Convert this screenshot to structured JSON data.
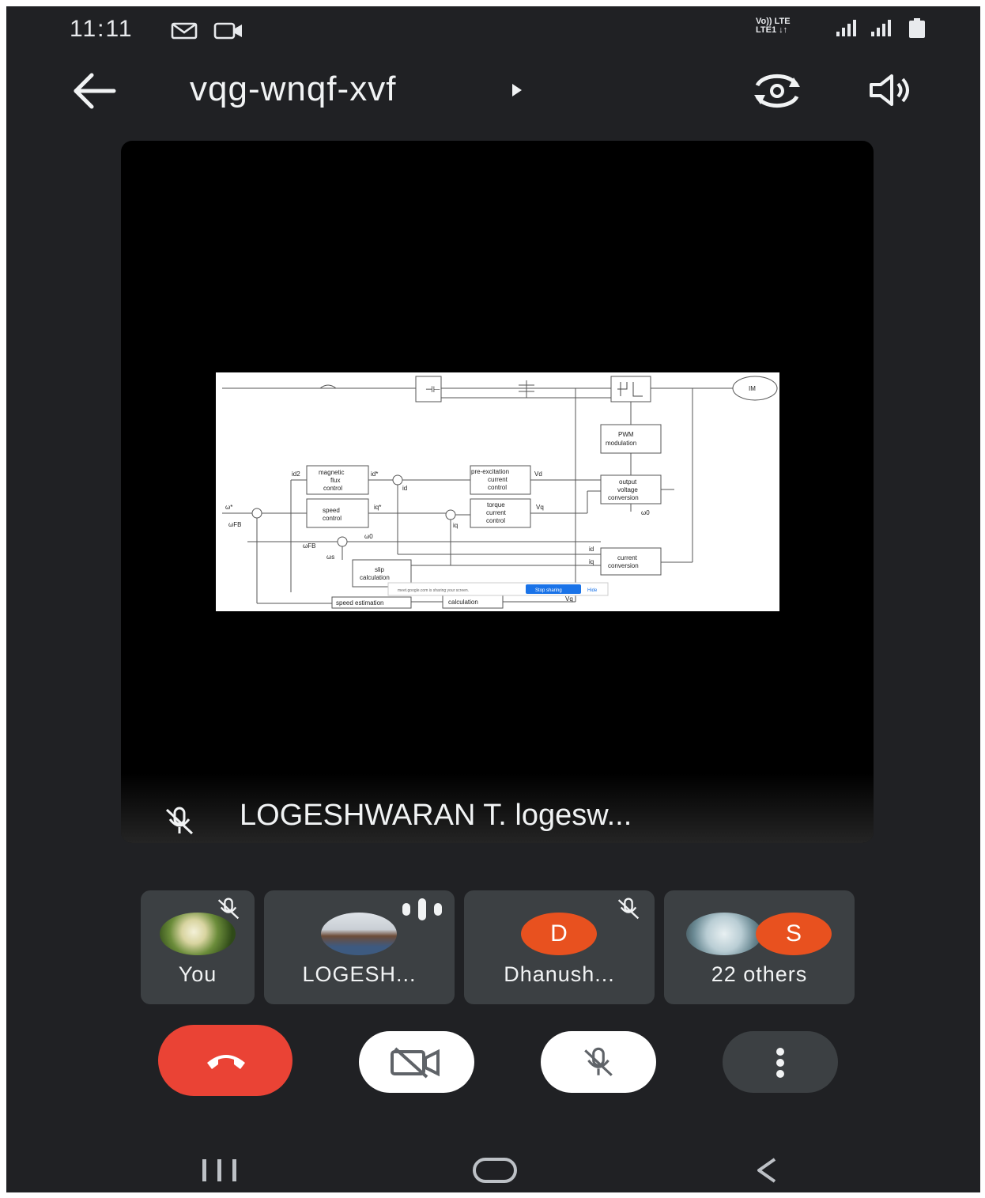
{
  "status_bar": {
    "time": "11:11",
    "network_line1": "Vo)) LTE",
    "network_line2": "LTE1 ↓↑"
  },
  "header": {
    "meeting_code": "vqg-wnqf-xvf"
  },
  "presenter": {
    "name": "LOGESHWARAN T. logesw..."
  },
  "participants": [
    {
      "name": "You",
      "muted": true
    },
    {
      "name": "LOGESH...",
      "speaking": true
    },
    {
      "name": "Dhanush...",
      "initial": "D",
      "muted": true
    },
    {
      "name": "22 others",
      "initial": "S"
    }
  ],
  "shared_screen": {
    "blocks": {
      "magnetic_flux": "magnetic flux control",
      "pre_excitation": "pre-excitation current control",
      "speed_control": "speed control",
      "torque_current": "torque current control",
      "pwm": "PWM modulation",
      "output_voltage": "output voltage conversion",
      "current_conversion": "current conversion",
      "slip": "slip calculation",
      "speed_estimation": "speed estimation",
      "calculation": "calculation",
      "motor": "IM"
    },
    "signals": {
      "id2": "id2",
      "id_star": "id*",
      "id": "id",
      "vd": "Vd",
      "iq_star": "iq*",
      "iq": "iq",
      "vq": "Vq",
      "w_star": "ω*",
      "wfb": "ωFB",
      "w0": "ω0",
      "wfb2": "ωFB",
      "ws": "ωs",
      "id_r": "id",
      "iq_r": "iq",
      "w0_r": "ω0",
      "vq_b": "Vq"
    },
    "share_bar_text": "meet.google.com is sharing your screen.",
    "stop_sharing": "Stop sharing",
    "hide": "Hide"
  },
  "colors": {
    "background": "#202124",
    "tile": "#3c4043",
    "end_call": "#ea4335",
    "avatar_orange": "#e8511f"
  },
  "icons": {
    "back": "arrow-left-icon",
    "switch_camera": "switch-camera-icon",
    "speaker": "speaker-icon",
    "mic_off": "mic-off-icon",
    "camera_off": "camera-off-icon",
    "end_call": "phone-hangup-icon",
    "more": "more-vert-icon"
  }
}
